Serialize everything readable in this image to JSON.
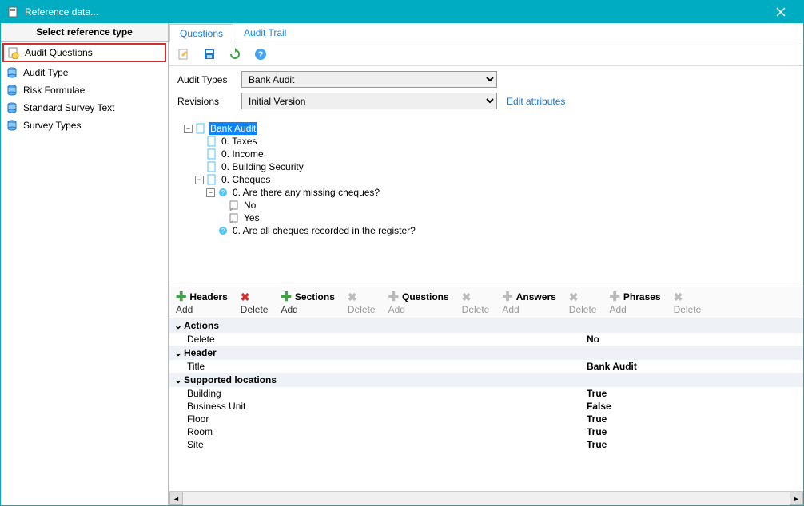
{
  "window": {
    "title": "Reference data..."
  },
  "sidebar": {
    "header": "Select reference type",
    "items": [
      {
        "label": "Audit Questions"
      },
      {
        "label": "Audit Type"
      },
      {
        "label": "Risk Formulae"
      },
      {
        "label": "Standard Survey Text"
      },
      {
        "label": "Survey Types"
      }
    ]
  },
  "tabs": [
    {
      "label": "Questions"
    },
    {
      "label": "Audit Trail"
    }
  ],
  "form": {
    "auditTypesLabel": "Audit Types",
    "auditTypesValue": "Bank Audit",
    "revisionsLabel": "Revisions",
    "revisionsValue": "Initial Version",
    "editAttributes": "Edit attributes"
  },
  "tree": {
    "root": "Bank Audit",
    "n0": "0. Taxes",
    "n1": "0. Income",
    "n2": "0. Building Security",
    "n3": "0. Cheques",
    "n3q0": "0. Are there any missing cheques?",
    "n3q0a0": "No",
    "n3q0a1": "Yes",
    "n3q1": "0. Are all cheques recorded in the register?"
  },
  "actionbar": {
    "headers": "Headers",
    "sections": "Sections",
    "questions": "Questions",
    "answers": "Answers",
    "phrases": "Phrases",
    "add": "Add",
    "delete": "Delete"
  },
  "props": {
    "sec_actions": "Actions",
    "actions_delete_k": "Delete",
    "actions_delete_v": "No",
    "sec_header": "Header",
    "header_title_k": "Title",
    "header_title_v": "Bank Audit",
    "sec_locations": "Supported locations",
    "loc_building_k": "Building",
    "loc_building_v": "True",
    "loc_bu_k": "Business Unit",
    "loc_bu_v": "False",
    "loc_floor_k": "Floor",
    "loc_floor_v": "True",
    "loc_room_k": "Room",
    "loc_room_v": "True",
    "loc_site_k": "Site",
    "loc_site_v": "True"
  }
}
